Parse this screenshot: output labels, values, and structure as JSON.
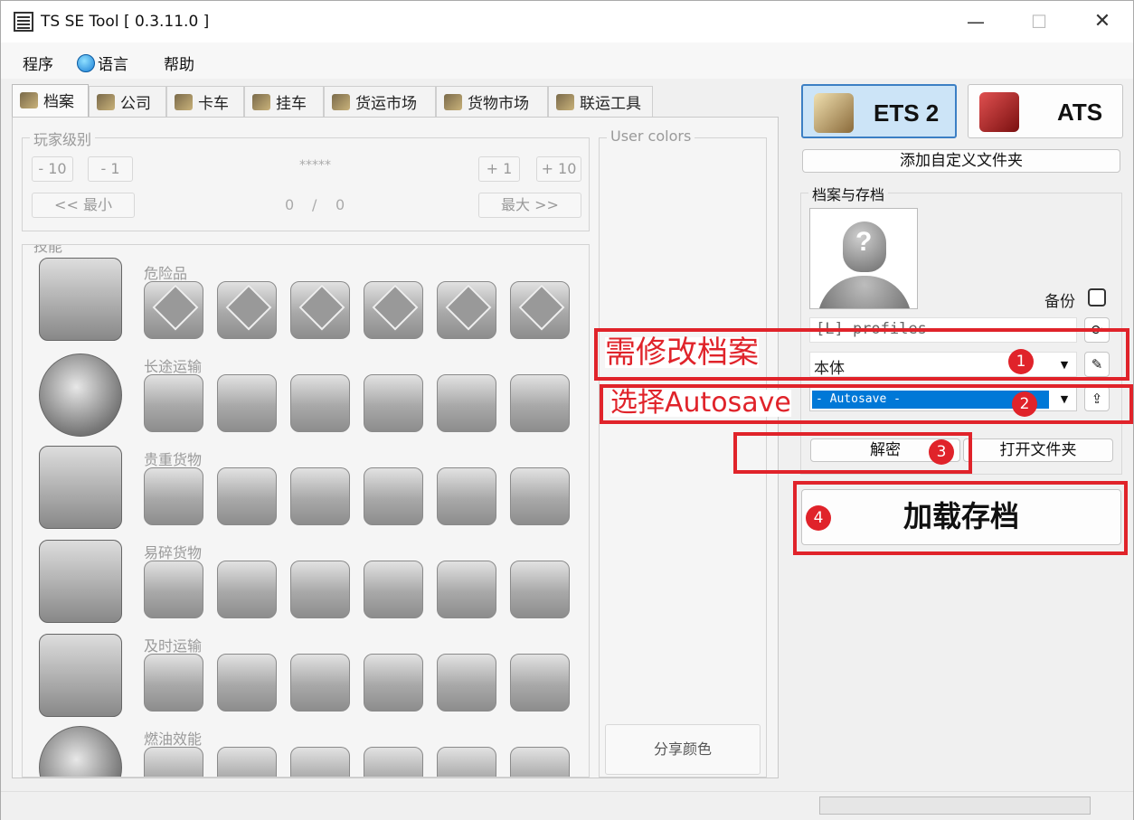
{
  "window": {
    "title": "TS SE Tool [ 0.3.11.0 ]"
  },
  "menu": [
    "程序",
    "语言",
    "帮助"
  ],
  "tabs": [
    "档案",
    "公司",
    "卡车",
    "挂车",
    "货运市场",
    "货物市场",
    "联运工具"
  ],
  "player_level": {
    "group_label": "玩家级别",
    "buttons": {
      "minus10": "- 10",
      "minus1": "- 1",
      "plus1": "+ 1",
      "plus10": "+ 10",
      "min": "<< 最小",
      "max": "最大 >>"
    },
    "stars": "*****",
    "value": "0",
    "separator": "/",
    "max_value": "0"
  },
  "skills": {
    "group_label": "技能",
    "rows": [
      {
        "name": "危险品"
      },
      {
        "name": "长途运输"
      },
      {
        "name": "贵重货物"
      },
      {
        "name": "易碎货物"
      },
      {
        "name": "及时运输"
      },
      {
        "name": "燃油效能"
      }
    ]
  },
  "user_colors": {
    "label": "User colors",
    "share_button": "分享颜色"
  },
  "games": [
    {
      "label": "ETS 2",
      "selected": true
    },
    {
      "label": "ATS",
      "selected": false
    }
  ],
  "right_panel": {
    "add_folder_button": "添加自定义文件夹",
    "group_label": "档案与存档",
    "backup_label": "备份",
    "profile_path_value": "[L] profiles",
    "profile_value": "本体",
    "save_value": "- Autosave -",
    "decrypt_button": "解密",
    "open_folder_button": "打开文件夹",
    "load_button": "加载存档"
  },
  "annotations": {
    "label1": "需修改档案",
    "label2": "选择Autosave",
    "num1": "1",
    "num2": "2",
    "num3": "3",
    "num4": "4",
    "color": "#e0232a"
  }
}
